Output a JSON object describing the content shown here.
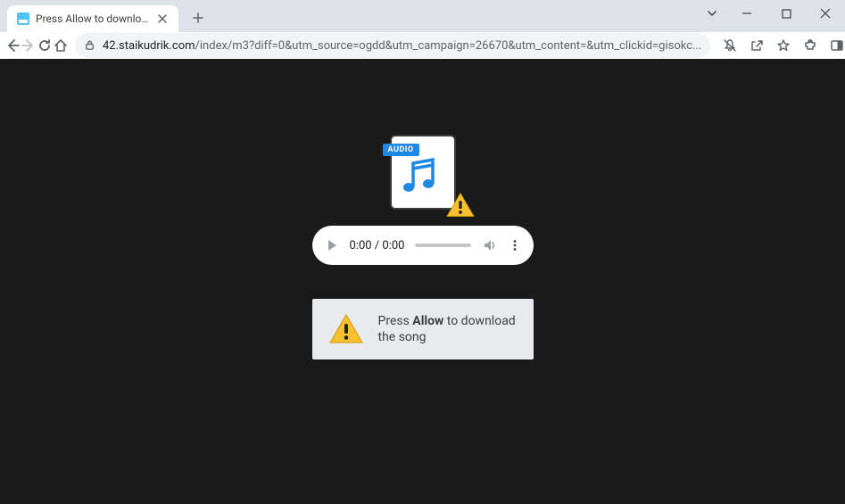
{
  "tab": {
    "title": "Press Allow to download the son",
    "close_aria": "Close tab"
  },
  "address": {
    "host": "42.staikudrik.com",
    "path": "/index/m3?diff=0&utm_source=ogdd&utm_campaign=26670&utm_content=&utm_clickid=gisokc..."
  },
  "player": {
    "current_time": "0:00",
    "duration": "0:00",
    "separator": " / "
  },
  "graphic": {
    "badge_text": "AUDIO"
  },
  "prompt": {
    "prefix": "Press ",
    "bold": "Allow",
    "suffix": " to download the song"
  }
}
